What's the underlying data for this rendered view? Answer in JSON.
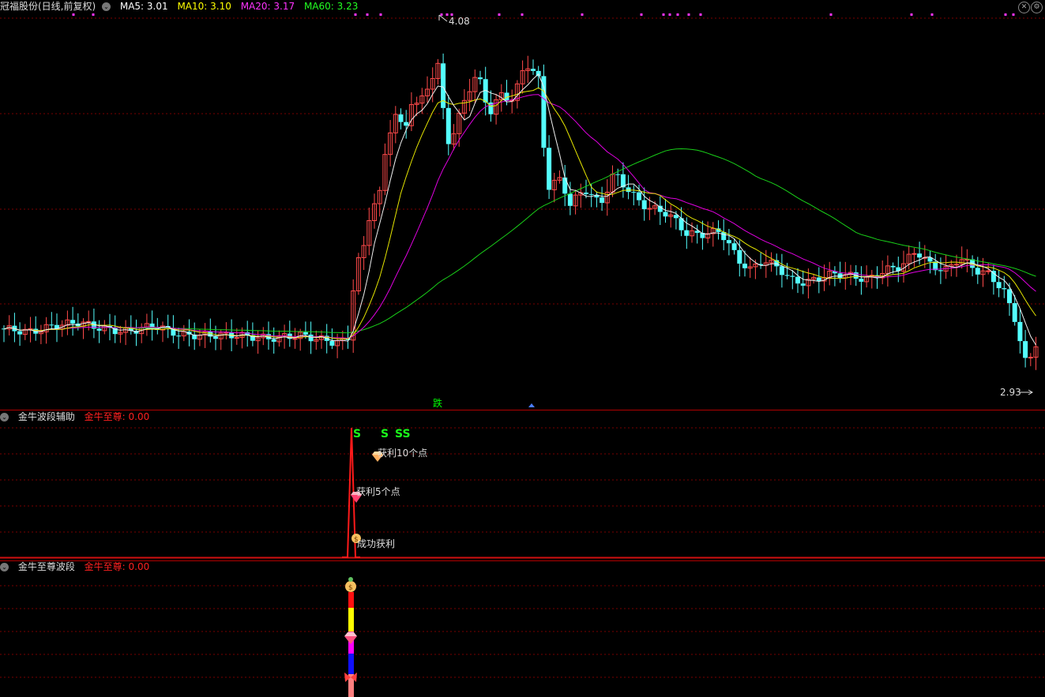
{
  "main_header": {
    "stock_title": "冠福股份(日线,前复权)",
    "ma5": "MA5: 3.01",
    "ma10": "MA10: 3.10",
    "ma20": "MA20: 3.17",
    "ma60": "MA60: 3.23"
  },
  "main_chart": {
    "high_label": "4.08",
    "low_label": "2.93",
    "fall_marker": "跌"
  },
  "panel1": {
    "title": "金牛波段辅助",
    "value_label": "金牛至尊: 0.00",
    "signal_s1": "S",
    "signal_s2": "S",
    "signal_ss": "SS",
    "profit10": "获利10个点",
    "profit5": "获利5个点",
    "success": "成功获利"
  },
  "panel2": {
    "title": "金牛至尊波段",
    "value_label": "金牛至尊: 0.00"
  },
  "colors": {
    "up": "#ff4a4a",
    "down": "#54ffff",
    "ma5": "#ffffff",
    "ma10": "#ffff00",
    "ma20": "#ff00ff",
    "ma60": "#00ff00",
    "grid": "#7a0000",
    "divider": "#b00000"
  },
  "icons": [
    "collapse-icon",
    "settings-icon",
    "close-icon",
    "money-bag-icon",
    "gem-icon",
    "butterfly-icon",
    "arrow-up-icon"
  ]
}
